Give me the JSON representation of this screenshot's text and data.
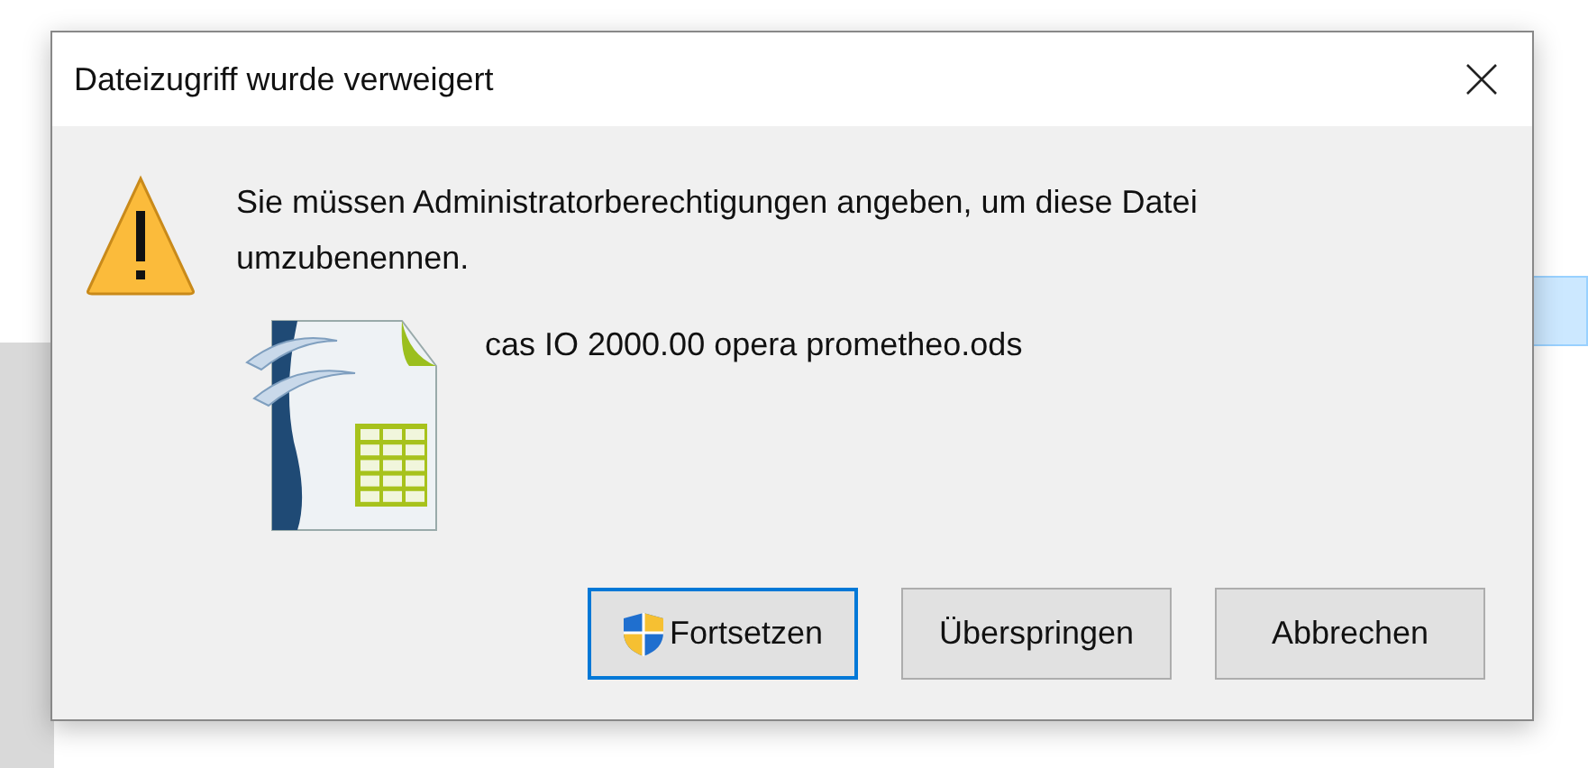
{
  "dialog": {
    "title": "Dateizugriff wurde verweigert",
    "message": "Sie müssen Administratorberechtigungen angeben, um diese Datei umzubenennen.",
    "file_name": "cas IO 2000.00 opera prometheo.ods",
    "buttons": [
      {
        "label": "Fortsetzen",
        "default": true,
        "shield": true
      },
      {
        "label": "Überspringen",
        "default": false,
        "shield": false
      },
      {
        "label": "Abbrechen",
        "default": false,
        "shield": false
      }
    ]
  }
}
